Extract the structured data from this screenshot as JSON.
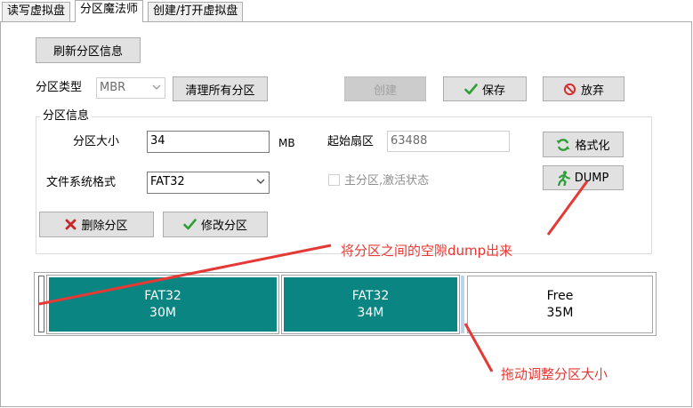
{
  "tabs": [
    "读写虚拟盘",
    "分区魔法师",
    "创建/打开虚拟盘"
  ],
  "refresh_button": "刷新分区信息",
  "partition_type": {
    "label": "分区类型",
    "value": "MBR"
  },
  "clear_all_button": "清理所有分区",
  "create_button": "创建",
  "save_button": "保存",
  "discard_button": "放弃",
  "info_group": {
    "title": "分区信息",
    "size_label": "分区大小",
    "size_value": "34",
    "size_unit": "MB",
    "start_sector_label": "起始扇区",
    "start_sector_value": "63488",
    "fs_label": "文件系统格式",
    "fs_value": "FAT32",
    "primary_active_label": "主分区,激活状态",
    "format_button": "格式化",
    "dump_button": "DUMP",
    "delete_button": "删除分区",
    "modify_button": "修改分区"
  },
  "partitions": [
    {
      "fs": "FAT32",
      "size": "30M"
    },
    {
      "fs": "FAT32",
      "size": "34M"
    },
    {
      "fs": "Free",
      "size": "35M"
    }
  ],
  "annotations": {
    "dump_note": "将分区之间的空隙dump出来",
    "resize_note": "拖动调整分区大小"
  },
  "colors": {
    "partition_used": "#0a8582",
    "annotation": "#e53935"
  }
}
